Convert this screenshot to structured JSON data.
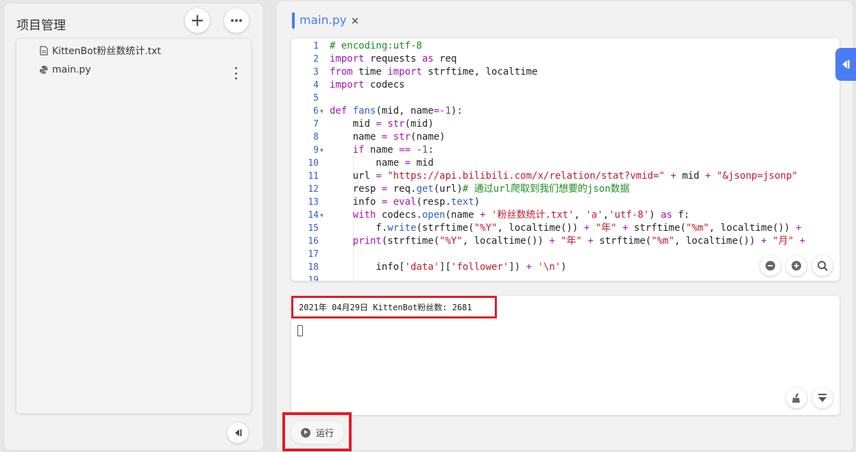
{
  "sidebar": {
    "title": "项目管理",
    "files": [
      {
        "name": "KittenBot粉丝数统计.txt",
        "icon": "text-file-icon"
      },
      {
        "name": "main.py",
        "icon": "python-icon"
      }
    ]
  },
  "editor": {
    "tab": {
      "label": "main.py",
      "close": "×"
    },
    "line_numbers": [
      "1",
      "2",
      "3",
      "4",
      "5",
      "6",
      "7",
      "8",
      "9",
      "10",
      "11",
      "12",
      "13",
      "14",
      "15",
      "16",
      "17",
      "18",
      "19"
    ]
  },
  "console": {
    "output": "2021年 04月29日 KittenBot粉丝数: 2681"
  },
  "run_button": {
    "label": "运行"
  },
  "colors": {
    "accent": "#4a7cf5",
    "highlight": "#e01b24"
  }
}
